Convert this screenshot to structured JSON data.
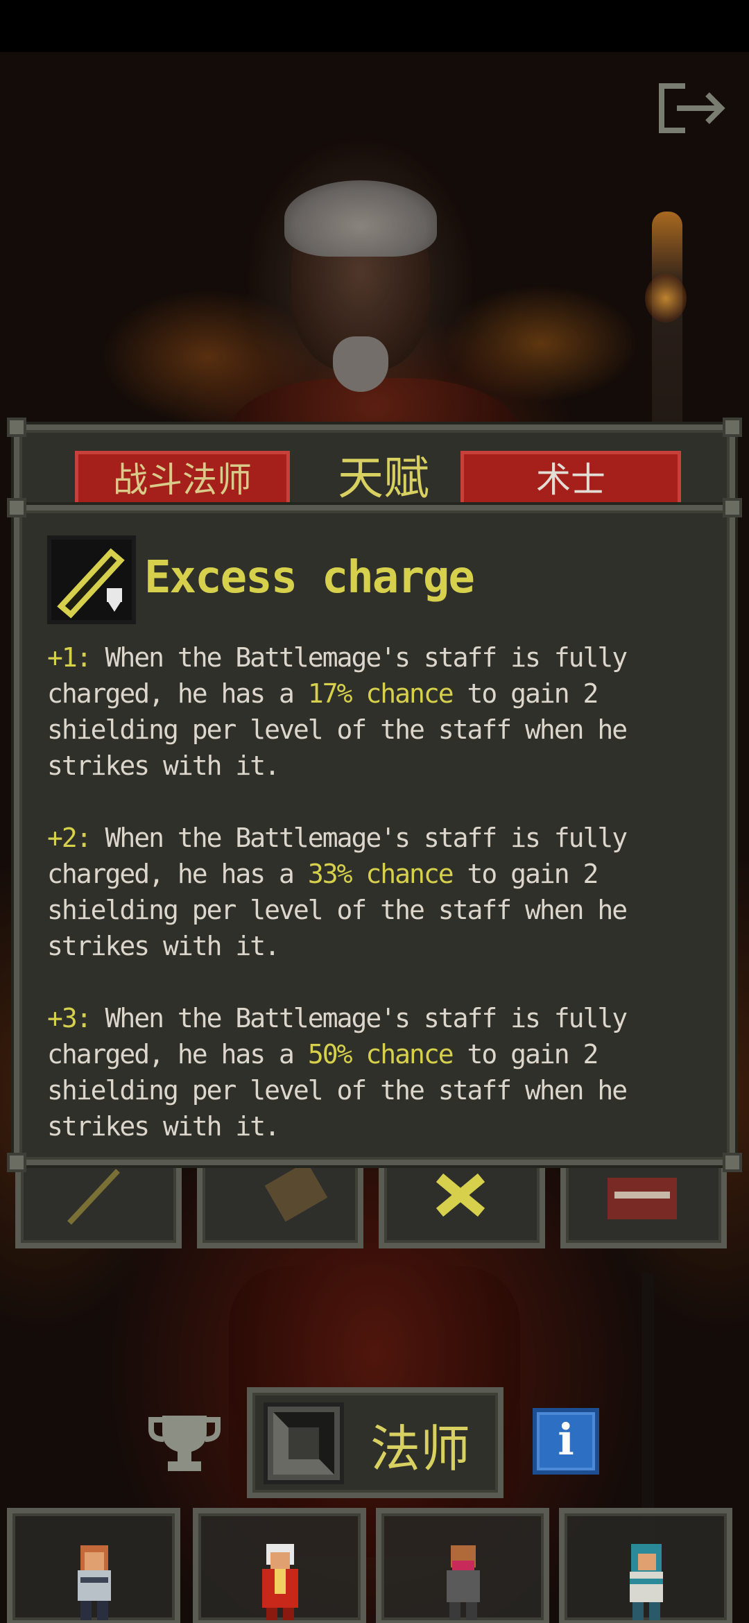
{
  "screen": {
    "name": "hero-select-talent-detail"
  },
  "exit_button": {
    "icon": "exit-icon"
  },
  "talent_tabs": {
    "left": "战斗法师",
    "middle": "天赋",
    "right": "术士"
  },
  "talent": {
    "icon": "staff-charge-icon",
    "title": "Excess charge",
    "levels": [
      {
        "prefix": "+1:",
        "text_a": " When the Battlemage's staff is fully charged, he has a ",
        "highlight": "17% chance",
        "text_b": " to gain 2 shielding per level of the staff when he strikes with it."
      },
      {
        "prefix": "+2:",
        "text_a": " When the Battlemage's staff is fully charged, he has a ",
        "highlight": "33% chance",
        "text_b": " to gain 2 shielding per level of the staff when he strikes with it."
      },
      {
        "prefix": "+3:",
        "text_a": " When the Battlemage's staff is fully charged, he has a ",
        "highlight": "50% chance",
        "text_b": " to gain 2 shielding per level of the staff when he strikes with it."
      }
    ]
  },
  "hero_bar": {
    "class_label": "法师",
    "trophy_icon": "trophy-icon",
    "info_label": "i"
  },
  "heroes": [
    "warrior",
    "mage",
    "rogue",
    "huntress"
  ],
  "colors": {
    "highlight": "#d6d04c",
    "panel": "#2f302a",
    "tab_red": "#a5201a",
    "info_blue": "#2d6fc2"
  }
}
